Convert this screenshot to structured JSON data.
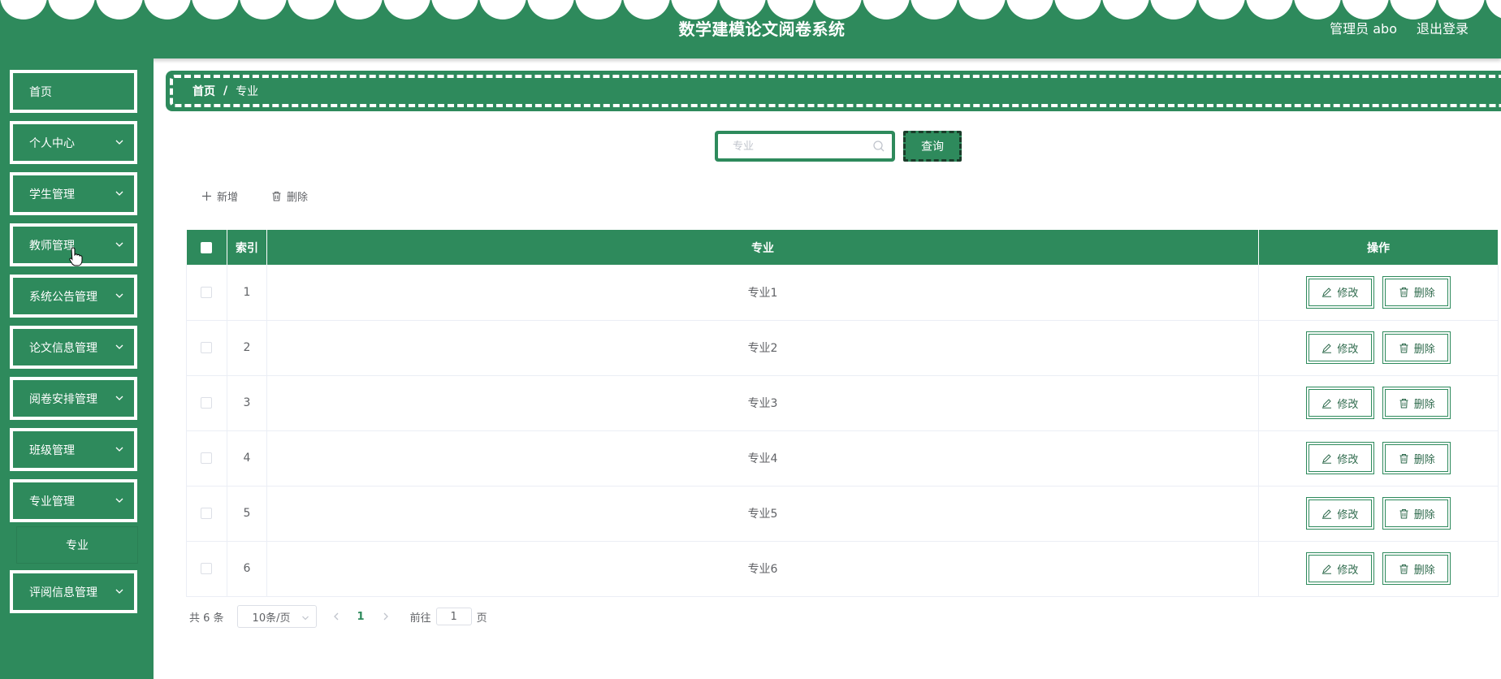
{
  "header": {
    "title": "数学建模论文阅卷系统",
    "user": "管理员 abo",
    "logout": "退出登录"
  },
  "sidebar": {
    "items": [
      {
        "label": "首页",
        "has_arrow": false
      },
      {
        "label": "个人中心",
        "has_arrow": true
      },
      {
        "label": "学生管理",
        "has_arrow": true
      },
      {
        "label": "教师管理",
        "has_arrow": true
      },
      {
        "label": "系统公告管理",
        "has_arrow": true
      },
      {
        "label": "论文信息管理",
        "has_arrow": true
      },
      {
        "label": "阅卷安排管理",
        "has_arrow": true
      },
      {
        "label": "班级管理",
        "has_arrow": true
      },
      {
        "label": "专业管理",
        "has_arrow": true,
        "expanded": true
      },
      {
        "label": "评阅信息管理",
        "has_arrow": true
      }
    ],
    "submenu": {
      "label": "专业"
    }
  },
  "breadcrumb": {
    "home": "首页",
    "separator": "/",
    "current": "专业"
  },
  "search": {
    "placeholder": "专业",
    "value": "",
    "button": "查询"
  },
  "toolbar": {
    "add": "新增",
    "delete": "删除"
  },
  "table": {
    "headers": {
      "index": "索引",
      "major": "专业",
      "operation": "操作"
    },
    "rows": [
      {
        "index": "1",
        "major": "专业1"
      },
      {
        "index": "2",
        "major": "专业2"
      },
      {
        "index": "3",
        "major": "专业3"
      },
      {
        "index": "4",
        "major": "专业4"
      },
      {
        "index": "5",
        "major": "专业5"
      },
      {
        "index": "6",
        "major": "专业6"
      }
    ],
    "edit_label": "修改",
    "delete_label": "删除"
  },
  "pagination": {
    "total": "共 6 条",
    "page_size": "10条/页",
    "current_page": "1",
    "goto_prefix": "前往",
    "goto_value": "1",
    "goto_suffix": "页"
  },
  "colors": {
    "primary": "#2e8a5c",
    "white": "#ffffff"
  },
  "icons": [
    "chevron-down-icon",
    "search-icon",
    "plus-icon",
    "trash-icon",
    "edit-icon",
    "chevron-left-icon",
    "chevron-right-icon",
    "pointer-cursor-icon"
  ]
}
